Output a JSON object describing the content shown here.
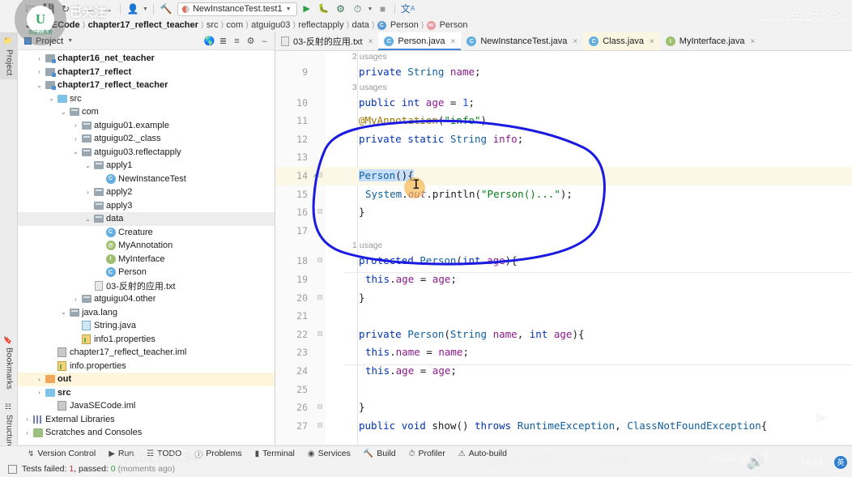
{
  "toolbar": {
    "icons": [
      "folder-open-icon",
      "save-icon",
      "sync-icon",
      "back-arrow-icon",
      "forward-arrow-icon",
      "user-icon",
      "hammer-icon"
    ],
    "run_config": "NewInstanceTest.test1",
    "run_label": "run-icon",
    "debug_label": "debug-icon",
    "coverage_label": "run-with-coverage-icon",
    "profile_label": "profile-icon",
    "stop_label": "stop-icon",
    "translate_label": "translate-icon"
  },
  "breadcrumb": {
    "items": [
      {
        "label": "JavaSECode",
        "bold": true,
        "badge": ""
      },
      {
        "label": "chapter17_reflect_teacher",
        "bold": true,
        "badge": ""
      },
      {
        "label": "src",
        "bold": false,
        "badge": ""
      },
      {
        "label": "com",
        "bold": false,
        "badge": ""
      },
      {
        "label": "atguigu03",
        "bold": false,
        "badge": ""
      },
      {
        "label": "reflectapply",
        "bold": false,
        "badge": ""
      },
      {
        "label": "data",
        "bold": false,
        "badge": ""
      },
      {
        "label": "Person",
        "bold": false,
        "badge": "C"
      },
      {
        "label": "Person",
        "bold": false,
        "badge": "m"
      }
    ]
  },
  "rail": {
    "items": [
      {
        "label": "Project",
        "icon": "project-icon",
        "active": true
      },
      {
        "label": "Bookmarks",
        "icon": "bookmark-icon",
        "active": false
      },
      {
        "label": "Structure",
        "icon": "structure-icon",
        "active": false
      }
    ]
  },
  "project_panel": {
    "title": "Project",
    "header_icons": [
      "globe-icon",
      "expand-all-icon",
      "collapse-all-icon",
      "gear-icon",
      "minimize-icon"
    ],
    "tree": [
      {
        "depth": 1,
        "arrow": ">",
        "icon": "module-folder",
        "label": "chapter16_net_teacher",
        "bold": true,
        "sel": ""
      },
      {
        "depth": 1,
        "arrow": ">",
        "icon": "module-folder",
        "label": "chapter17_reflect",
        "bold": true,
        "sel": ""
      },
      {
        "depth": 1,
        "arrow": "v",
        "icon": "module-folder",
        "label": "chapter17_reflect_teacher",
        "bold": true,
        "sel": ""
      },
      {
        "depth": 2,
        "arrow": "v",
        "icon": "source-folder",
        "label": "src",
        "bold": false,
        "sel": ""
      },
      {
        "depth": 3,
        "arrow": "v",
        "icon": "package",
        "label": "com",
        "bold": false,
        "sel": ""
      },
      {
        "depth": 4,
        "arrow": ">",
        "icon": "package",
        "label": "atguigu01.example",
        "bold": false,
        "sel": ""
      },
      {
        "depth": 4,
        "arrow": ">",
        "icon": "package",
        "label": "atguigu02._class",
        "bold": false,
        "sel": ""
      },
      {
        "depth": 4,
        "arrow": "v",
        "icon": "package",
        "label": "atguigu03.reflectapply",
        "bold": false,
        "sel": ""
      },
      {
        "depth": 5,
        "arrow": "v",
        "icon": "package",
        "label": "apply1",
        "bold": false,
        "sel": ""
      },
      {
        "depth": 6,
        "arrow": "",
        "icon": "class-run",
        "label": "NewInstanceTest",
        "bold": false,
        "sel": ""
      },
      {
        "depth": 5,
        "arrow": ">",
        "icon": "package",
        "label": "apply2",
        "bold": false,
        "sel": ""
      },
      {
        "depth": 5,
        "arrow": "",
        "icon": "package",
        "label": "apply3",
        "bold": false,
        "sel": ""
      },
      {
        "depth": 5,
        "arrow": "v",
        "icon": "package",
        "label": "data",
        "bold": false,
        "sel": "grey"
      },
      {
        "depth": 6,
        "arrow": "",
        "icon": "class",
        "label": "Creature",
        "bold": false,
        "sel": ""
      },
      {
        "depth": 6,
        "arrow": "",
        "icon": "annotation",
        "label": "MyAnnotation",
        "bold": false,
        "sel": ""
      },
      {
        "depth": 6,
        "arrow": "",
        "icon": "interface",
        "label": "MyInterface",
        "bold": false,
        "sel": ""
      },
      {
        "depth": 6,
        "arrow": "",
        "icon": "class",
        "label": "Person",
        "bold": false,
        "sel": ""
      },
      {
        "depth": 5,
        "arrow": "",
        "icon": "textfile",
        "label": "03-反射的应用.txt",
        "bold": false,
        "sel": ""
      },
      {
        "depth": 4,
        "arrow": ">",
        "icon": "package",
        "label": "atguigu04.other",
        "bold": false,
        "sel": ""
      },
      {
        "depth": 3,
        "arrow": "v",
        "icon": "package",
        "label": "java.lang",
        "bold": false,
        "sel": ""
      },
      {
        "depth": 4,
        "arrow": "",
        "icon": "javafile",
        "label": "String.java",
        "bold": false,
        "sel": ""
      },
      {
        "depth": 4,
        "arrow": "",
        "icon": "properties",
        "label": "info1.properties",
        "bold": false,
        "sel": ""
      },
      {
        "depth": 2,
        "arrow": "",
        "icon": "iml",
        "label": "chapter17_reflect_teacher.iml",
        "bold": false,
        "sel": ""
      },
      {
        "depth": 2,
        "arrow": "",
        "icon": "properties",
        "label": "info.properties",
        "bold": false,
        "sel": ""
      },
      {
        "depth": 1,
        "arrow": ">",
        "icon": "out-folder",
        "label": "out",
        "bold": true,
        "sel": "yellow"
      },
      {
        "depth": 1,
        "arrow": ">",
        "icon": "source-folder",
        "label": "src",
        "bold": true,
        "sel": ""
      },
      {
        "depth": 2,
        "arrow": "",
        "icon": "iml",
        "label": "JavaSECode.iml",
        "bold": false,
        "sel": ""
      },
      {
        "depth": 0,
        "arrow": ">",
        "icon": "library",
        "label": "External Libraries",
        "bold": false,
        "sel": ""
      },
      {
        "depth": 0,
        "arrow": ">",
        "icon": "scratch",
        "label": "Scratches and Consoles",
        "bold": false,
        "sel": ""
      }
    ]
  },
  "editor": {
    "tabs": [
      {
        "label": "03-反射的应用.txt",
        "icon": "txt-icon",
        "state": ""
      },
      {
        "label": "Person.java",
        "icon": "class-icon",
        "state": "active"
      },
      {
        "label": "NewInstanceTest.java",
        "icon": "class-run-icon",
        "state": ""
      },
      {
        "label": "Class.java",
        "icon": "class-icon",
        "state": "tint"
      },
      {
        "label": "MyInterface.java",
        "icon": "interface-icon",
        "state": ""
      }
    ],
    "lines": [
      {
        "num": "",
        "kind": "usage",
        "text": "2 usages"
      },
      {
        "num": "9",
        "kind": "code",
        "text": "private String name;"
      },
      {
        "num": "",
        "kind": "usage",
        "text": "3 usages"
      },
      {
        "num": "10",
        "kind": "code",
        "text": "public int age = 1;"
      },
      {
        "num": "11",
        "kind": "code",
        "text": "@MyAnnotation(\"info\")"
      },
      {
        "num": "12",
        "kind": "code",
        "text": "private static String info;"
      },
      {
        "num": "13",
        "kind": "code",
        "text": ""
      },
      {
        "num": "14",
        "kind": "code",
        "text": "Person(){"
      },
      {
        "num": "15",
        "kind": "code",
        "text": "System.out.println(\"Person()...\");"
      },
      {
        "num": "16",
        "kind": "code",
        "text": "}"
      },
      {
        "num": "17",
        "kind": "code",
        "text": ""
      },
      {
        "num": "",
        "kind": "usage",
        "text": "1 usage"
      },
      {
        "num": "18",
        "kind": "code",
        "text": "protected Person(int age){"
      },
      {
        "num": "19",
        "kind": "code",
        "text": "this.age = age;"
      },
      {
        "num": "20",
        "kind": "code",
        "text": "}"
      },
      {
        "num": "21",
        "kind": "code",
        "text": ""
      },
      {
        "num": "22",
        "kind": "code",
        "text": "private Person(String name, int age){"
      },
      {
        "num": "23",
        "kind": "code",
        "text": "this.name = name;"
      },
      {
        "num": "24",
        "kind": "code",
        "text": "this.age = age;"
      },
      {
        "num": "25",
        "kind": "code",
        "text": ""
      },
      {
        "num": "26",
        "kind": "code",
        "text": "}"
      },
      {
        "num": "27",
        "kind": "code",
        "text": "public void show() throws RuntimeException, ClassNotFoundException{"
      }
    ]
  },
  "toolwindow_bar": {
    "items": [
      {
        "label": "Version Control",
        "icon": "branch-icon"
      },
      {
        "label": "Run",
        "icon": "run-icon"
      },
      {
        "label": "TODO",
        "icon": "todo-icon"
      },
      {
        "label": "Problems",
        "icon": "problems-icon"
      },
      {
        "label": "Terminal",
        "icon": "terminal-icon"
      },
      {
        "label": "Services",
        "icon": "services-icon"
      },
      {
        "label": "Build",
        "icon": "build-icon"
      },
      {
        "label": "Profiler",
        "icon": "profiler-icon"
      },
      {
        "label": "Auto-build",
        "icon": "warning-icon"
      }
    ]
  },
  "statusbar": {
    "icon": "tests-icon",
    "prefix": "Tests failed: ",
    "failed": "1",
    "mid": ", passed: ",
    "passed": "0",
    "suffix": " (moments ago)"
  },
  "video_overlay": {
    "time": "00:01 / 50:34",
    "quality": "1080P 高清",
    "speed": "倍速",
    "volume_icon": "volume-icon",
    "settings_icon": "gear-icon",
    "clock": "14:14",
    "ime": "英"
  },
  "watermarks": {
    "top_right": "尚硅谷",
    "csdn": "CSDN @IT学...",
    "follow_label": "已关注",
    "avatar_letter": "U",
    "avatar_sub": "尚硅谷教育"
  },
  "colors": {
    "accent": "#4585d6",
    "annotation_blue": "#1a1ae0",
    "cursor_highlight": "#f3b03d",
    "keyword": "#0033b3",
    "string": "#067d17",
    "field": "#8b1a8b"
  }
}
